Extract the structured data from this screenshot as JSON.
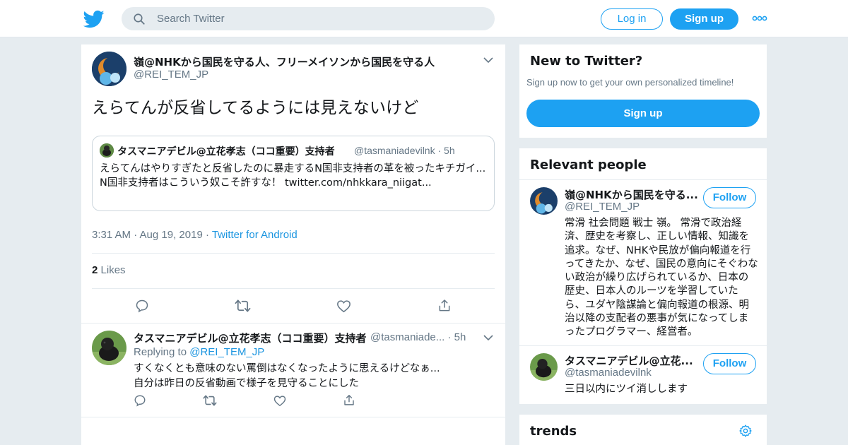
{
  "topbar": {
    "search_placeholder": "Search Twitter",
    "login_label": "Log in",
    "signup_label": "Sign up"
  },
  "tweet": {
    "author_name": "嶺@NHKから国民を守る人、フリーメイソンから国民を守る人",
    "author_handle": "@REI_TEM_JP",
    "text": "えらてんが反省してるようには見えないけど",
    "quote": {
      "author_name": "タスマニアデビル@立花孝志（ココ重要）支持者",
      "author_handle": "@tasmaniadevilnk · 5h",
      "line1": "えらてんはやりすぎたと反省したのに暴走するN国非支持者の革を被ったキチガイ...",
      "line2": "N国非支持者はこういう奴こそ許すな！ twitter.com/nhkkara_niigat..."
    },
    "time": "3:31 AM · Aug 19, 2019 · ",
    "source": "Twitter for Android",
    "likes_count": "2",
    "likes_label": "Likes"
  },
  "reply": {
    "author_name": "タスマニアデビル@立花孝志（ココ重要）支持者",
    "author_handle": "@tasmaniade... · 5h",
    "replying_prefix": "Replying to ",
    "replying_to": "@REI_TEM_JP",
    "line1": "すくなくとも意味のない罵倒はなくなったように思えるけどなぁ...",
    "line2": "自分は昨日の反省動画で様子を見守ることにした"
  },
  "new_to_twitter": {
    "title": "New to Twitter?",
    "subtitle": "Sign up now to get your own personalized timeline!",
    "button": "Sign up"
  },
  "relevant_people": {
    "title": "Relevant people",
    "follow_label": "Follow",
    "people": [
      {
        "name": "嶺@NHKから国民を守る...",
        "handle": "@REI_TEM_JP",
        "bio": "常滑 社会問題 戦士 嶺。 常滑で政治経済、歴史を考察し、正しい情報、知識を追求。なぜ、NHKや民放が偏向報道を行ってきたか、なぜ、国民の意向にそぐわない政治が繰り広げられているか、日本の歴史、日本人のルーツを学習していたら、ユダヤ陰謀論と偏向報道の根源、明治以降の支配者の悪事が気になってしまったプログラマー、経営者。"
      },
      {
        "name": "タスマニアデビル@立花...",
        "handle": "@tasmaniadevilnk",
        "bio": "三日以内にツイ消しします"
      }
    ]
  },
  "trends": {
    "title": "trends"
  },
  "colors": {
    "accent": "#1da1f2",
    "link": "#1b95e0",
    "muted": "#657786",
    "background": "#e6ecf0"
  }
}
